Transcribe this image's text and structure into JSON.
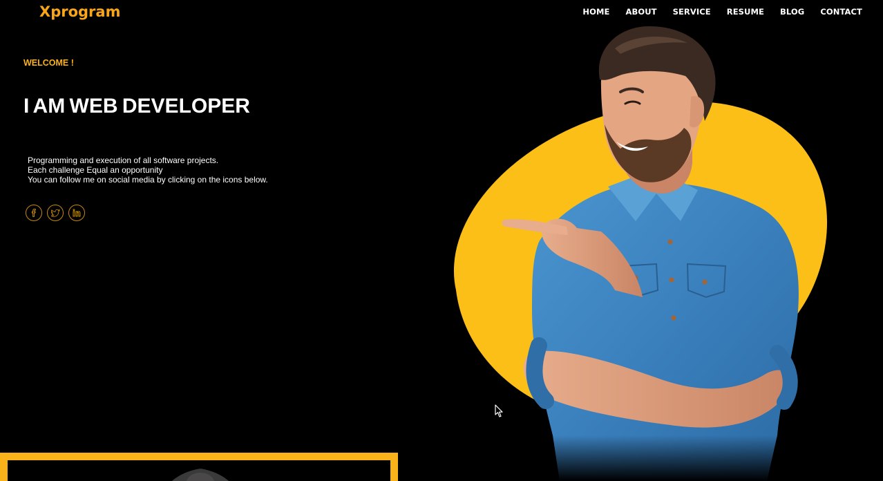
{
  "brand": {
    "name": "Xprogram",
    "accent_color": "#f9b21a"
  },
  "nav": {
    "items": [
      {
        "label": "HOME"
      },
      {
        "label": "ABOUT"
      },
      {
        "label": "SERVICE"
      },
      {
        "label": "RESUME"
      },
      {
        "label": "BLOG"
      },
      {
        "label": "CONTACT"
      }
    ]
  },
  "hero": {
    "welcome": "WELCOME !",
    "headline": "I AM WEB DEVELOPER",
    "description": [
      "Programming and execution of all software projects.",
      "Each challenge Equal an opportunity",
      "You can follow me on social media by clicking on the icons below."
    ],
    "socials": [
      {
        "icon": "facebook-icon"
      },
      {
        "icon": "twitter-icon"
      },
      {
        "icon": "linkedin-icon"
      }
    ],
    "image": "smiling-man-pointing-left"
  }
}
